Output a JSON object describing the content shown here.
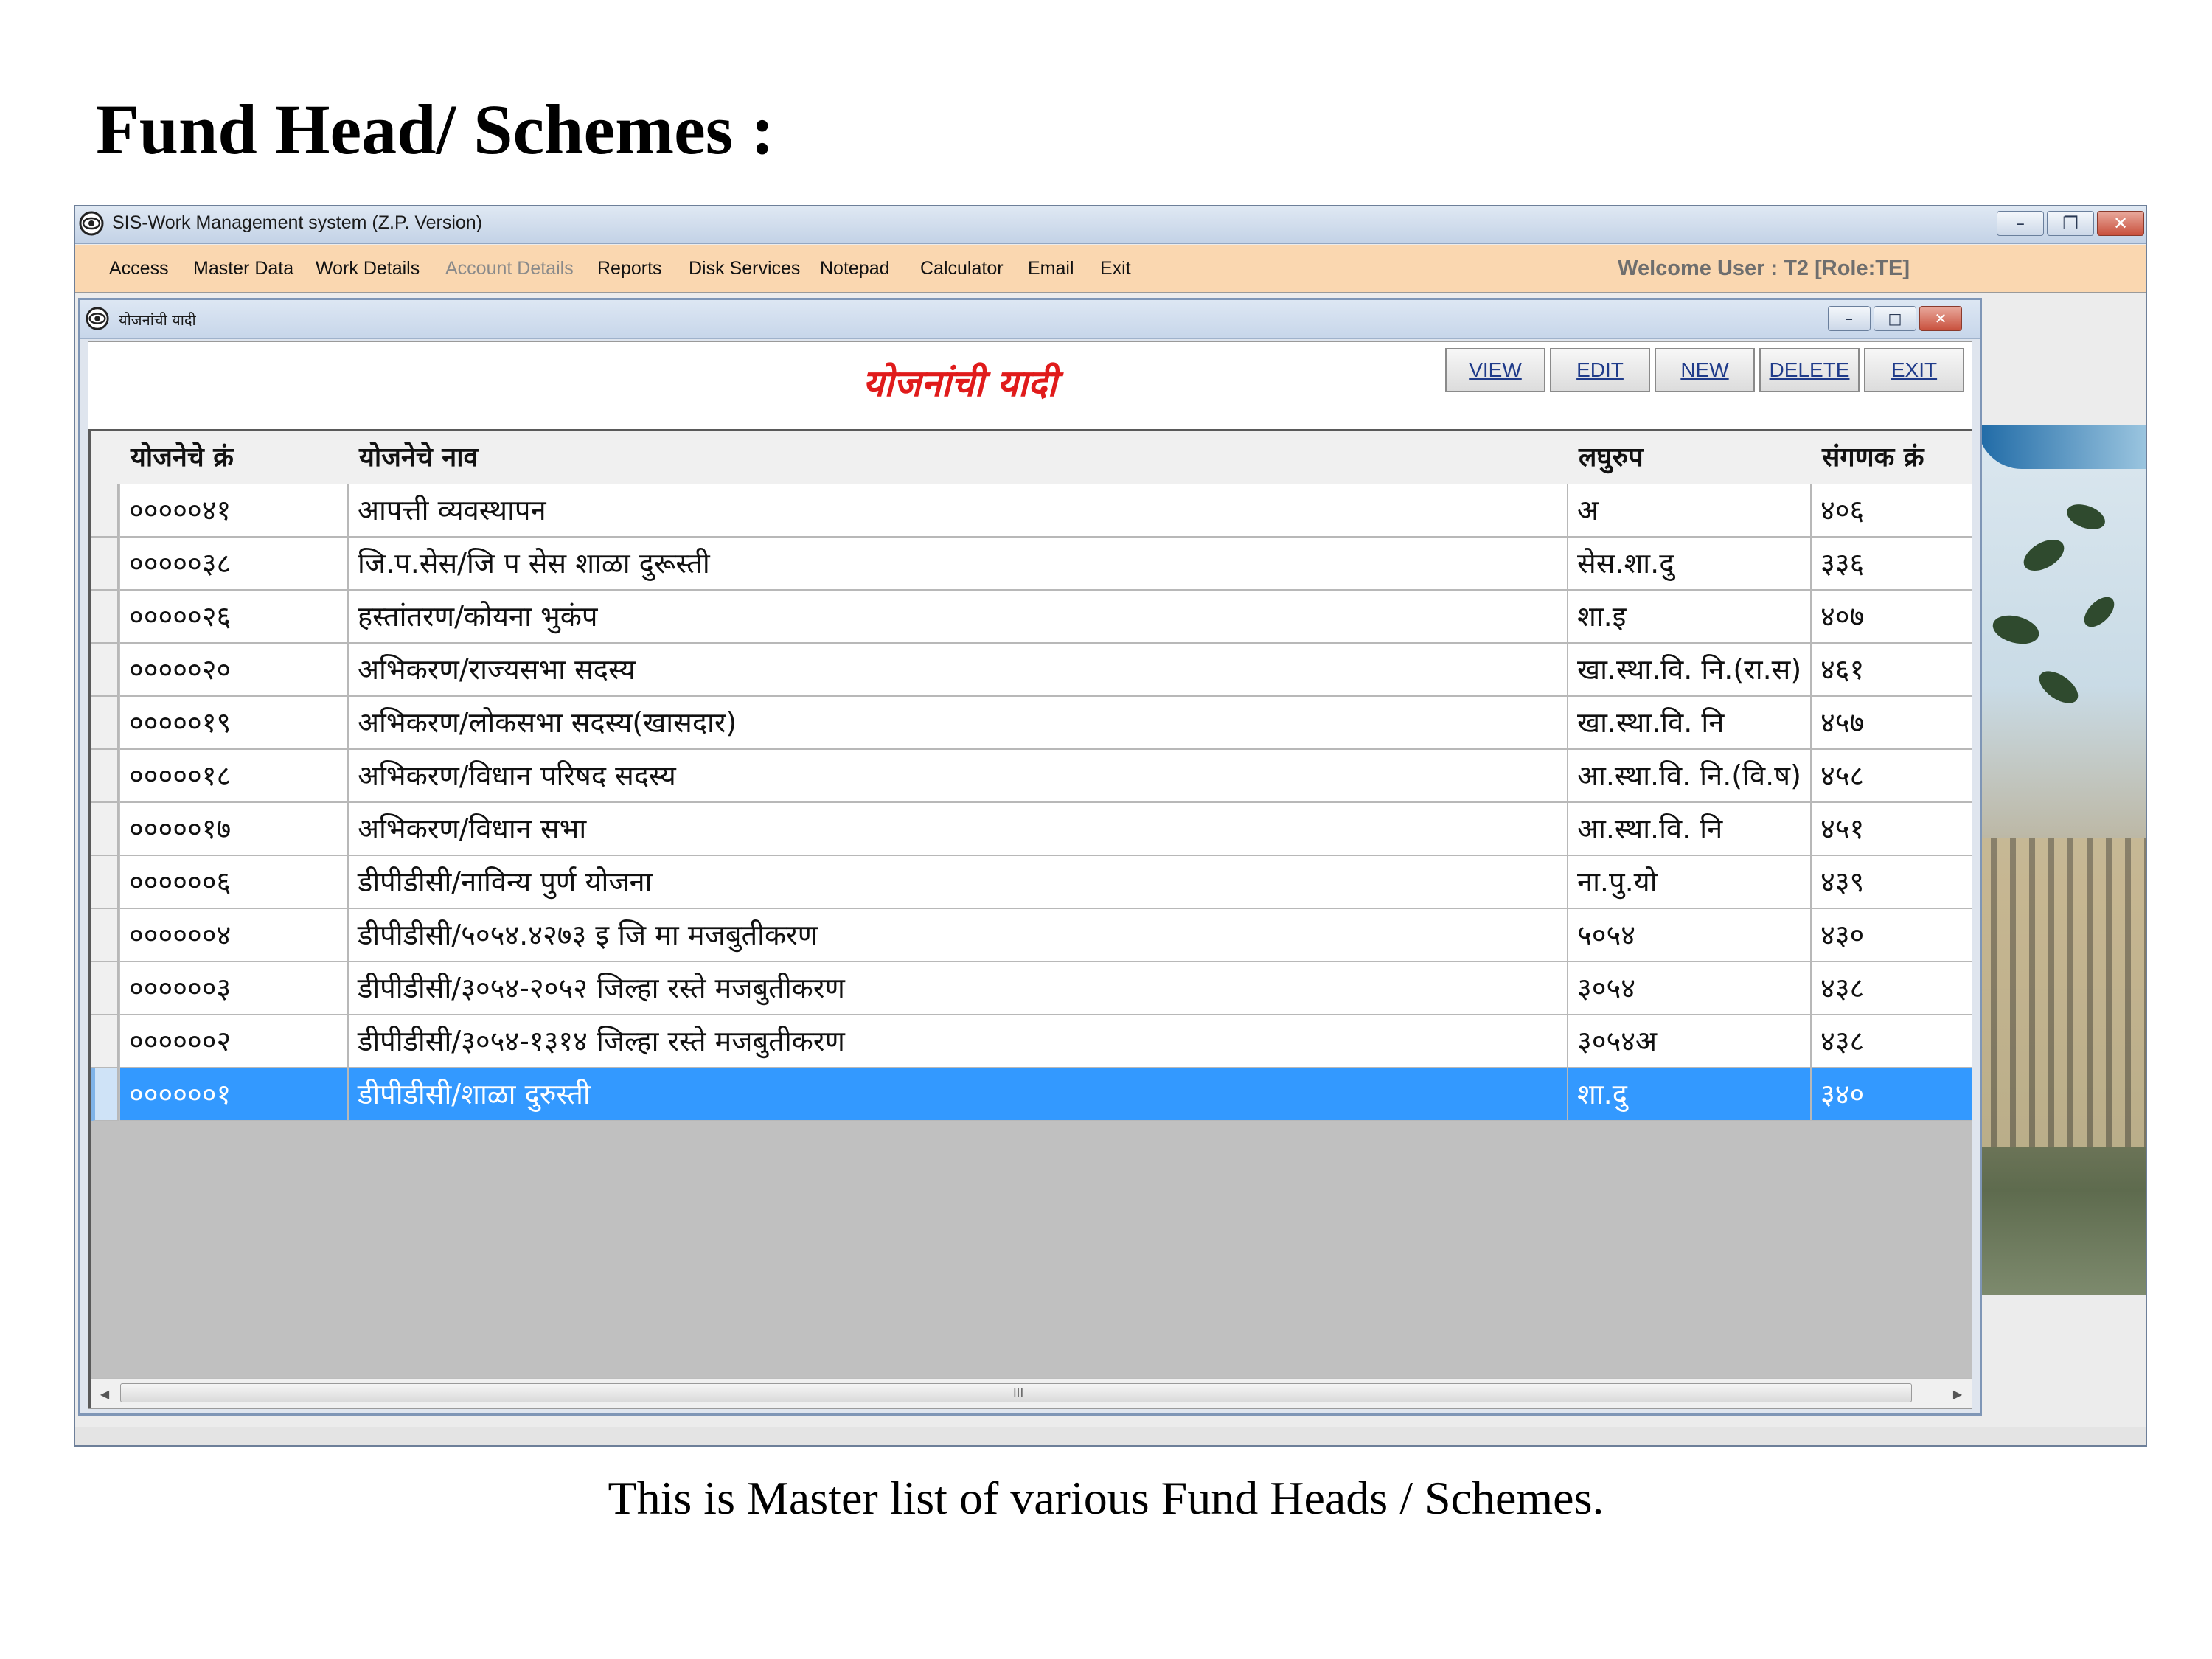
{
  "page": {
    "heading": "Fund Head/ Schemes :",
    "caption": "This is Master list of various Fund Heads / Schemes."
  },
  "app": {
    "title": "SIS-Work Management system (Z.P. Version)",
    "window_buttons": [
      "minimize",
      "restore",
      "close"
    ],
    "menu": [
      {
        "label": "Access",
        "enabled": true
      },
      {
        "label": "Master Data",
        "enabled": true
      },
      {
        "label": "Work Details",
        "enabled": true
      },
      {
        "label": "Account Details",
        "enabled": false
      },
      {
        "label": "Reports",
        "enabled": true
      },
      {
        "label": "Disk Services",
        "enabled": true
      },
      {
        "label": "Notepad",
        "enabled": true
      },
      {
        "label": "Calculator",
        "enabled": true
      },
      {
        "label": "Email",
        "enabled": true
      },
      {
        "label": "Exit",
        "enabled": true
      }
    ],
    "welcome": "Welcome User : T2 [Role:TE]",
    "menubar_color": "#fad7b0"
  },
  "child": {
    "title": "योजनांची यादी",
    "form_title": "योजनांची यादी",
    "form_title_color": "#e01b1b",
    "actions": {
      "view": "VIEW",
      "edit": "EDIT",
      "new": "NEW",
      "delete": "DELETE",
      "exit": "EXIT"
    },
    "columns": [
      "योजनेचे क्रं",
      "योजनेचे नाव",
      "लघुरुप",
      "संगणक क्रं"
    ],
    "rows": [
      {
        "code": "०००००४१",
        "name": "आपत्ती व्यवस्थापन",
        "short": "अ",
        "computer_no": "४०६"
      },
      {
        "code": "०००००३८",
        "name": "जि.प.सेस/जि प सेस शाळा दुरूस्ती",
        "short": "सेस.शा.दु",
        "computer_no": "३३६"
      },
      {
        "code": "०००००२६",
        "name": "हस्तांतरण/कोयना भुकंप",
        "short": "शा.इ",
        "computer_no": "४०७"
      },
      {
        "code": "०००००२०",
        "name": "अभिकरण/राज्यसभा सदस्य",
        "short": "खा.स्था.वि. नि.(रा.स)",
        "computer_no": "४६१"
      },
      {
        "code": "०००००१९",
        "name": "अभिकरण/लोकसभा सदस्य(खासदार)",
        "short": "खा.स्था.वि. नि",
        "computer_no": "४५७"
      },
      {
        "code": "०००००१८",
        "name": "अभिकरण/विधान परिषद सदस्य",
        "short": "आ.स्था.वि. नि.(वि.ष)",
        "computer_no": "४५८"
      },
      {
        "code": "०००००१७",
        "name": "अभिकरण/विधान सभा",
        "short": "आ.स्था.वि. नि",
        "computer_no": "४५१"
      },
      {
        "code": "००००००६",
        "name": "डीपीडीसी/नाविन्य पुर्ण योजना",
        "short": "ना.पु.यो",
        "computer_no": "४३९"
      },
      {
        "code": "००००००४",
        "name": "डीपीडीसी/५०५४.४२७३ इ जि मा मजबुतीकरण",
        "short": "५०५४",
        "computer_no": "४३०"
      },
      {
        "code": "००००००३",
        "name": "डीपीडीसी/३०५४-२०५२ जिल्हा रस्ते मजबुतीकरण",
        "short": "३०५४",
        "computer_no": "४३८"
      },
      {
        "code": "००००००२",
        "name": "डीपीडीसी/३०५४-१३१४ जिल्हा रस्ते मजबुतीकरण",
        "short": "३०५४अ",
        "computer_no": "४३८"
      },
      {
        "code": "००००००१",
        "name": "डीपीडीसी/शाळा दुरुस्ती",
        "short": "शा.दु",
        "computer_no": "३४०",
        "selected": true
      }
    ],
    "scrollbar_grip": "III",
    "selection_color": "#3399ff"
  }
}
